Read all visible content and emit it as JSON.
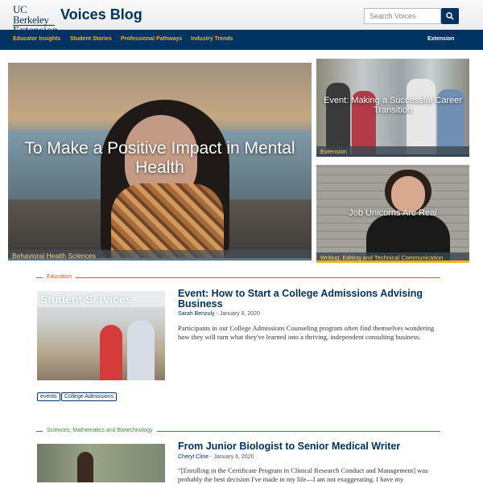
{
  "header": {
    "logo_line1": "UC Berkeley",
    "logo_line2": "Extension",
    "blog_title": "Voices Blog",
    "search_placeholder": "Search Voices",
    "search_icon": "search-icon",
    "brand_color": "#003262",
    "accent_color": "#fdb515"
  },
  "nav": {
    "items": [
      "Educator Insights",
      "Student Stories",
      "Professional Pathways",
      "Industry Trends"
    ],
    "right": "Extension"
  },
  "featured": {
    "main": {
      "title": "To Make a Positive Impact in Mental Health",
      "label": "Behavioral Health Sciences"
    },
    "side": [
      {
        "title": "Event: Making a Successful Career Transition",
        "label": "Extension"
      },
      {
        "title": "Job Unicorns Are Real",
        "label": "Writing, Editing and Technical Communication"
      }
    ]
  },
  "posts": [
    {
      "category": "Education",
      "category_color": "#d8552f",
      "thumb_sign": "Student Services",
      "title": "Event: How to Start a College Admissions Advising Business",
      "author": "Sarah Benzuly",
      "date": " - January 8, 2020",
      "excerpt": "Participants in our College Admissions Counseling program often find themselves wondering how they will turn what they've learned into a thriving, independent consulting business.",
      "tags": [
        "events",
        "College Admissions"
      ]
    },
    {
      "category": "Sciences, Mathematics and Biotechnology",
      "category_color": "#3a8a3a",
      "title": "From Junior Biologist to Senior Medical Writer",
      "author": "Cheryl Cline",
      "date": " - January 6, 2020",
      "excerpt": "“[Enrolling in the Certificate Program in Clinical Research Conduct and Management] was probably the best decision I've made in my life—I am not exaggerating. I have my"
    }
  ]
}
